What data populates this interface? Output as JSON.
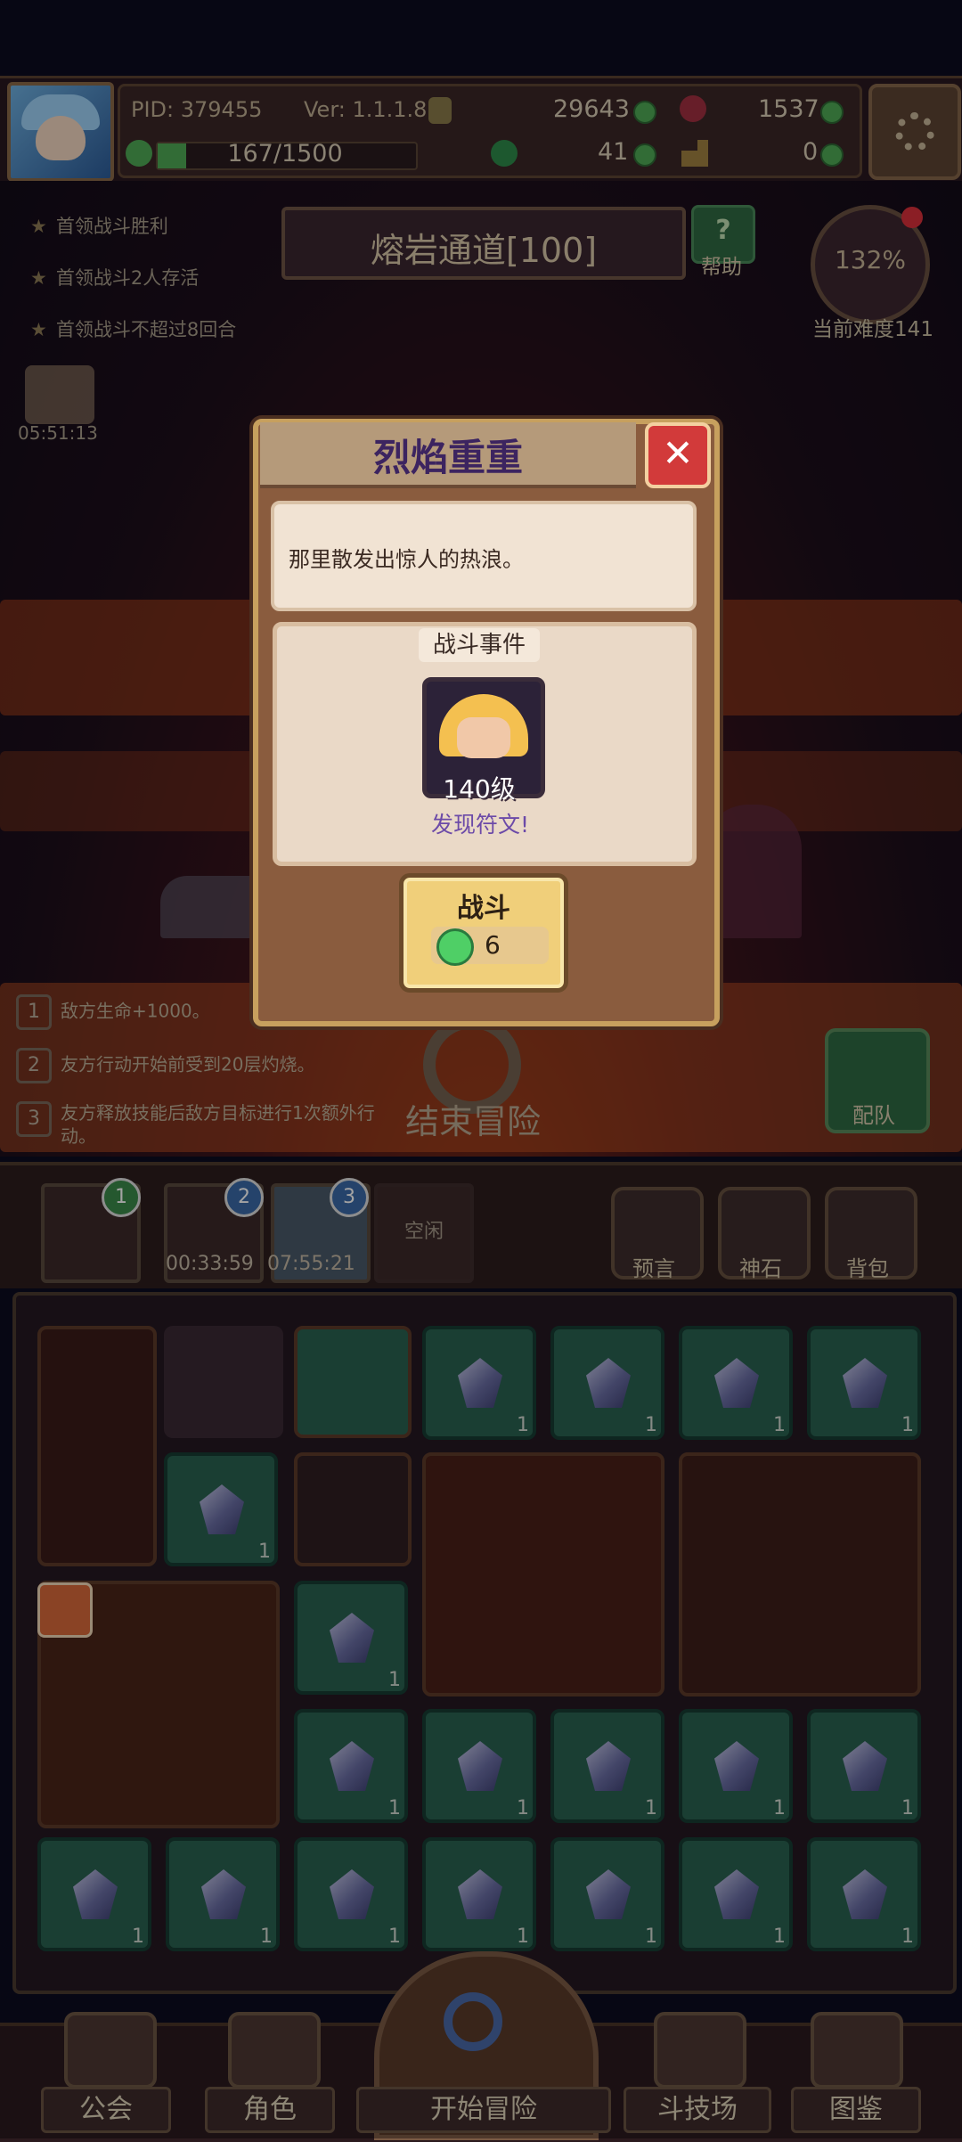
{
  "header": {
    "pid": "PID: 379455",
    "version": "Ver: 1.1.1.8",
    "gold": "29643",
    "red_gems": "1537",
    "exp": "167/1500",
    "exp_fraction": 0.111,
    "clover": "41",
    "key": "0"
  },
  "stage": {
    "name": "熔岩通道[100]",
    "help_label": "帮助",
    "difficulty_pct": "132%",
    "difficulty_label": "当前难度141",
    "gift_timer": "05:51:13",
    "objectives": [
      "首领战斗胜利",
      "首领战斗2人存活",
      "首领战斗不超过8回合"
    ],
    "modifiers": [
      {
        "num": "1",
        "text": "敌方生命+1000。"
      },
      {
        "num": "2",
        "text": "友方行动开始前受到20层灼烧。"
      },
      {
        "num": "3",
        "text": "友方释放技能后敌方目标进行1次额外行动。"
      }
    ],
    "end_adventure": "结束冒险",
    "team_label": "配队"
  },
  "dialog": {
    "title": "烈焰重重",
    "description": "那里散发出惊人的热浪。",
    "event_header": "战斗事件",
    "enemy_level": "140级",
    "reward_text": "发现符文!",
    "fight_label": "战斗",
    "fight_cost": "6"
  },
  "slots": {
    "badges": [
      "1",
      "2",
      "3"
    ],
    "timers": [
      "00:33:59",
      "07:55:21"
    ],
    "idle_label": "空闲",
    "buttons": [
      "预言",
      "神石",
      "背包"
    ]
  },
  "inventory": {
    "count_label": "1"
  },
  "nav": {
    "items": [
      "公会",
      "角色",
      "开始冒险",
      "斗技场",
      "图鉴"
    ]
  },
  "colors": {
    "dialog_title": "#3c2460",
    "rune_text": "#6c4aa8",
    "close_red": "#d23a3a",
    "cell_green": "#2a6150"
  }
}
